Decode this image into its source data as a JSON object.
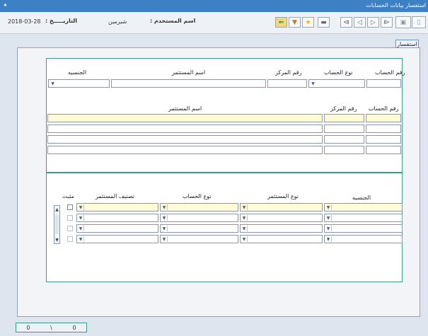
{
  "window": {
    "title": "استفسار بيانات الحسابات",
    "app_icon": "app-icon"
  },
  "header": {
    "date_label": "التاريـــــخ :",
    "date_value": "2018-03-28",
    "user_label": "اسم المستخدم :",
    "user_value": "شيرمين"
  },
  "toolbar": {
    "icons": [
      "exit-icon",
      "bookmark-icon",
      "star-icon",
      "print-icon",
      "first-record-icon",
      "previous-record-icon",
      "next-record-icon",
      "last-record-icon",
      "save-icon",
      "new-icon"
    ]
  },
  "tab": {
    "label": "استفسار"
  },
  "search": {
    "account_no_label": "رقم الحساب",
    "account_type_label": "نوع الحساب",
    "center_no_label": "رقم المركز",
    "investor_name_label": "اسم المستثمر",
    "nationality_label": "الجنسيه"
  },
  "results": {
    "columns": {
      "account_no": "رقم الحساب",
      "center_no": "رقم المركز",
      "investor_name": "اسم المستثمر"
    },
    "rows": [
      {
        "account_no": "",
        "center_no": "",
        "investor_name": ""
      },
      {
        "account_no": "",
        "center_no": "",
        "investor_name": ""
      },
      {
        "account_no": "",
        "center_no": "",
        "investor_name": ""
      },
      {
        "account_no": "",
        "center_no": "",
        "investor_name": ""
      }
    ]
  },
  "details": {
    "columns": {
      "nationality": "الجنسيه",
      "investor_type": "نوع المستثمر",
      "account_type": "نوع الحساب",
      "investor_class": "تصنيف المستثمر",
      "fixed": "مثبت"
    }
  },
  "status": {
    "current": "0",
    "separator": "\\",
    "total": "0"
  }
}
